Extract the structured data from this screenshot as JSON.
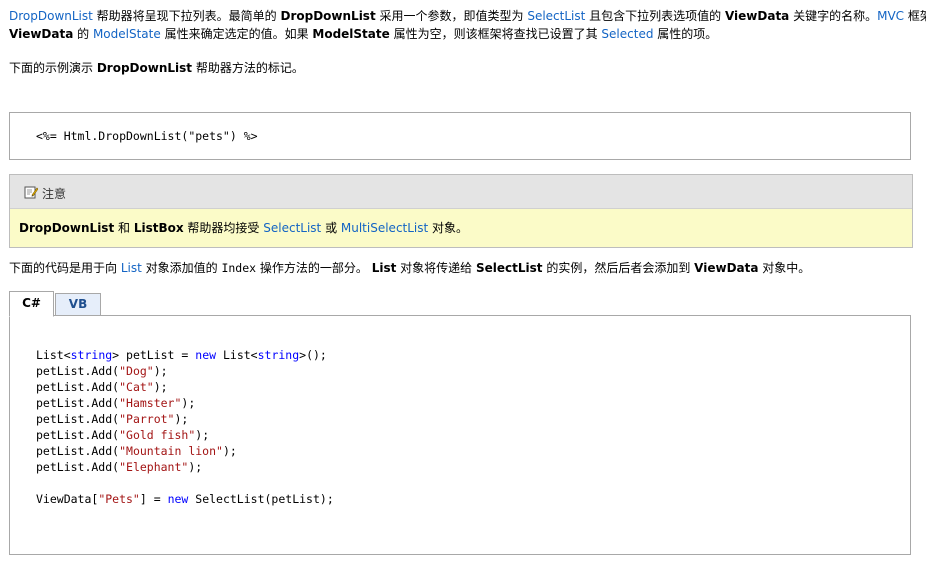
{
  "para1": {
    "line1": [
      {
        "t": "DropDownList",
        "s": "link"
      },
      {
        "t": " 帮助器将呈现下拉列表。最简单的 ",
        "s": ""
      },
      {
        "t": "DropDownList",
        "s": "b"
      },
      {
        "t": " 采用一个参数，即值类型为 ",
        "s": ""
      },
      {
        "t": "SelectList",
        "s": "link"
      },
      {
        "t": " 且包含下拉列表选项值的 ",
        "s": ""
      },
      {
        "t": "ViewData",
        "s": "b"
      },
      {
        "t": " 关键字的名称。",
        "s": ""
      },
      {
        "t": "MVC",
        "s": "link"
      },
      {
        "t": " 框架使用",
        "s": ""
      }
    ],
    "line2": [
      {
        "t": "ViewData",
        "s": "b"
      },
      {
        "t": " 的 ",
        "s": ""
      },
      {
        "t": "ModelState",
        "s": "link"
      },
      {
        "t": " 属性来确定选定的值。如果 ",
        "s": ""
      },
      {
        "t": "ModelState",
        "s": "b"
      },
      {
        "t": " 属性为空，则该框架将查找已设置了其 ",
        "s": ""
      },
      {
        "t": "Selected",
        "s": "link"
      },
      {
        "t": " 属性的项。",
        "s": ""
      }
    ]
  },
  "para2": [
    {
      "t": "下面的示例演示 ",
      "s": ""
    },
    {
      "t": "DropDownList",
      "s": "b"
    },
    {
      "t": " 帮助器方法的标记。",
      "s": ""
    }
  ],
  "code1": "<%= Html.DropDownList(\"pets\") %>",
  "note": {
    "title": "注意",
    "body": [
      {
        "t": "DropDownList",
        "s": "b"
      },
      {
        "t": " 和 ",
        "s": ""
      },
      {
        "t": "ListBox",
        "s": "b"
      },
      {
        "t": " 帮助器均接受 ",
        "s": ""
      },
      {
        "t": "SelectList",
        "s": "link"
      },
      {
        "t": " 或 ",
        "s": ""
      },
      {
        "t": "MultiSelectList",
        "s": "link"
      },
      {
        "t": " 对象。",
        "s": ""
      }
    ]
  },
  "para3": [
    {
      "t": "下面的代码是用于向 ",
      "s": ""
    },
    {
      "t": "List",
      "s": "link"
    },
    {
      "t": " 对象添加值的 ",
      "s": ""
    },
    {
      "t": "Index",
      "s": "mono"
    },
    {
      "t": " 操作方法的一部分。 ",
      "s": ""
    },
    {
      "t": "List",
      "s": "b"
    },
    {
      "t": " 对象将传递给 ",
      "s": ""
    },
    {
      "t": "SelectList",
      "s": "b"
    },
    {
      "t": " 的实例，然后后者会添加到 ",
      "s": ""
    },
    {
      "t": "ViewData",
      "s": "b"
    },
    {
      "t": " 对象中。",
      "s": ""
    }
  ],
  "tabs": [
    {
      "label": "C#",
      "active": true
    },
    {
      "label": "VB",
      "active": false
    }
  ],
  "code2_lines": [
    [
      {
        "t": "List<",
        "s": ""
      },
      {
        "t": "string",
        "s": "kw"
      },
      {
        "t": "> petList = ",
        "s": ""
      },
      {
        "t": "new",
        "s": "kw"
      },
      {
        "t": " List<",
        "s": ""
      },
      {
        "t": "string",
        "s": "kw"
      },
      {
        "t": ">();",
        "s": ""
      }
    ],
    [
      {
        "t": "petList.Add(",
        "s": ""
      },
      {
        "t": "\"Dog\"",
        "s": "str"
      },
      {
        "t": ");",
        "s": ""
      }
    ],
    [
      {
        "t": "petList.Add(",
        "s": ""
      },
      {
        "t": "\"Cat\"",
        "s": "str"
      },
      {
        "t": ");",
        "s": ""
      }
    ],
    [
      {
        "t": "petList.Add(",
        "s": ""
      },
      {
        "t": "\"Hamster\"",
        "s": "str"
      },
      {
        "t": ");",
        "s": ""
      }
    ],
    [
      {
        "t": "petList.Add(",
        "s": ""
      },
      {
        "t": "\"Parrot\"",
        "s": "str"
      },
      {
        "t": ");",
        "s": ""
      }
    ],
    [
      {
        "t": "petList.Add(",
        "s": ""
      },
      {
        "t": "\"Gold fish\"",
        "s": "str"
      },
      {
        "t": ");",
        "s": ""
      }
    ],
    [
      {
        "t": "petList.Add(",
        "s": ""
      },
      {
        "t": "\"Mountain lion\"",
        "s": "str"
      },
      {
        "t": ");",
        "s": ""
      }
    ],
    [
      {
        "t": "petList.Add(",
        "s": ""
      },
      {
        "t": "\"Elephant\"",
        "s": "str"
      },
      {
        "t": ");",
        "s": ""
      }
    ],
    [],
    [
      {
        "t": "ViewData[",
        "s": ""
      },
      {
        "t": "\"Pets\"",
        "s": "str"
      },
      {
        "t": "] = ",
        "s": ""
      },
      {
        "t": "new",
        "s": "kw"
      },
      {
        "t": " SelectList(petList);",
        "s": ""
      }
    ]
  ],
  "colors": {
    "link": "#1364c4",
    "keyword": "#0000ff",
    "string": "#a31515",
    "note_background": "#fbfbc8",
    "note_header": "#e4e4e4"
  },
  "icons": {
    "note": "note-pencil-icon"
  }
}
